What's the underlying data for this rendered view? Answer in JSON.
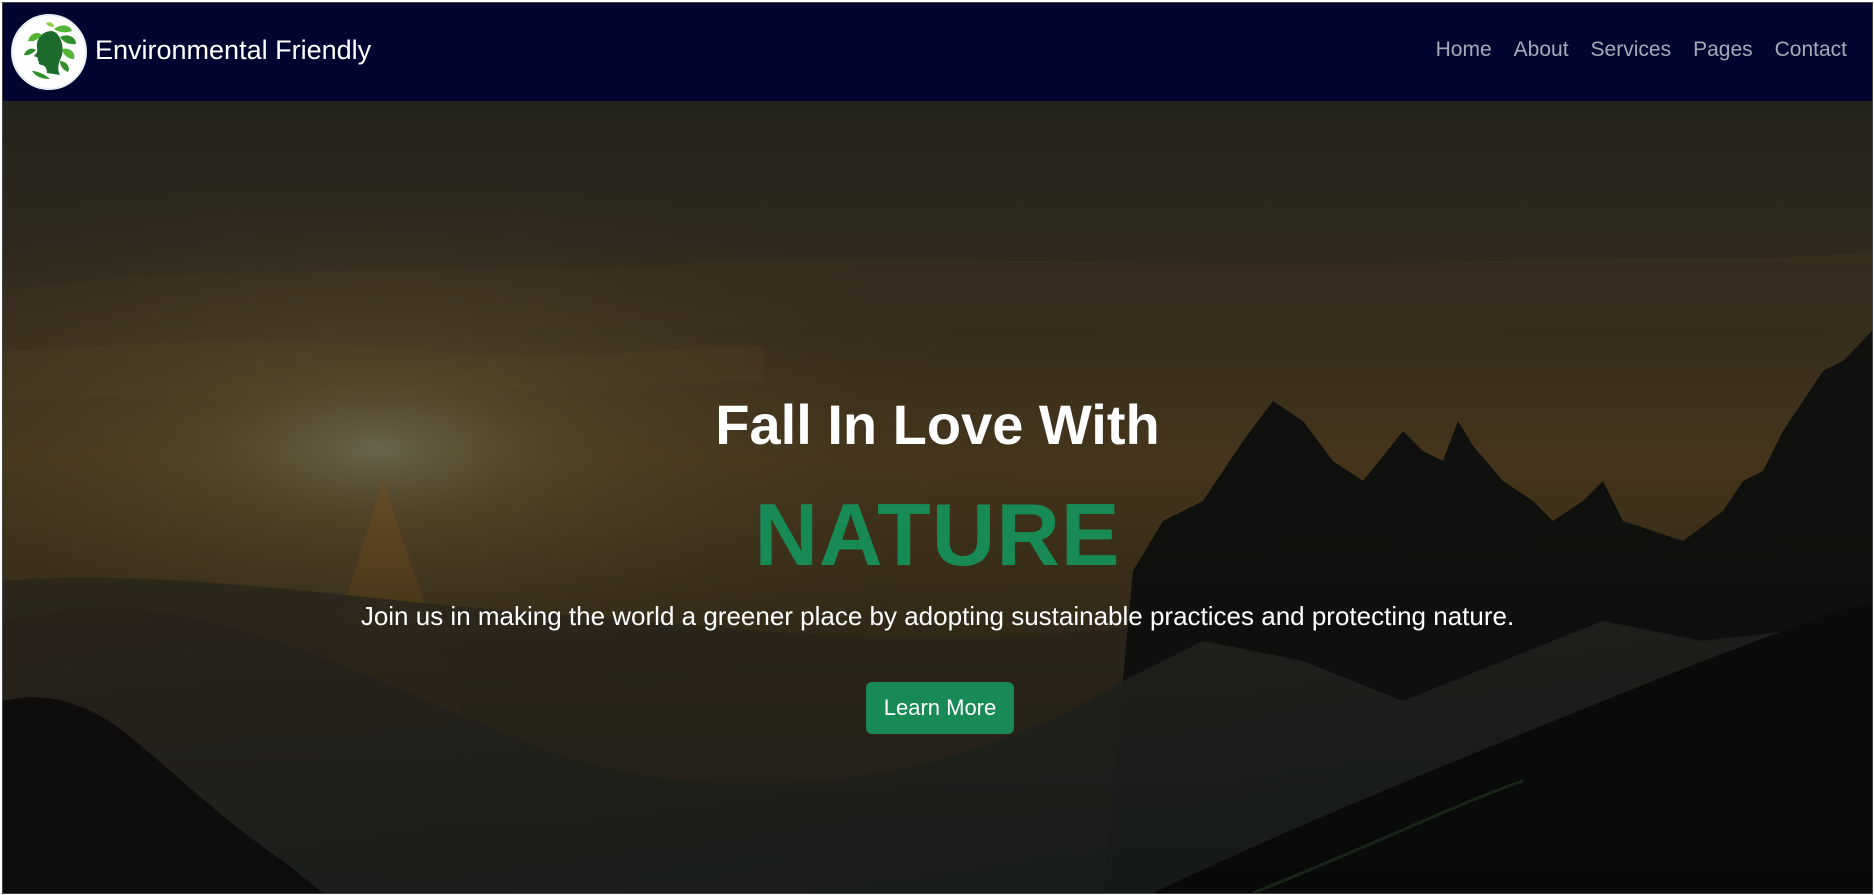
{
  "navbar": {
    "brand_name": "Environmental Friendly",
    "logo_icon": "leaf-face-logo-icon",
    "links": [
      "Home",
      "About",
      "Services",
      "Pages",
      "Contact"
    ]
  },
  "hero": {
    "title": "Fall In Love With",
    "highlight": "NATURE",
    "description": "Join us in making the world a greener place by adopting sustainable practices and protecting nature.",
    "button_label": "Learn More",
    "background": "mountain-sunset-image"
  },
  "colors": {
    "navbar_bg": "#020530",
    "accent_green": "#178a56",
    "nav_link": "#a7a9b6",
    "text": "#ffffff"
  }
}
